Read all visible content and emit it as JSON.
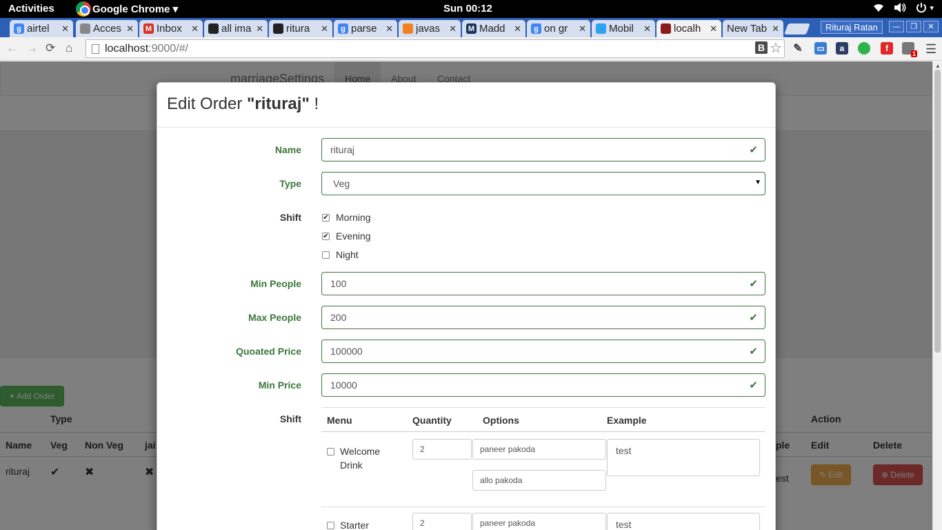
{
  "system": {
    "activities": "Activities",
    "app_name": "Google Chrome ▾",
    "clock": "Sun 00:12",
    "tray": [
      "wifi-icon",
      "volume-icon",
      "power-icon"
    ]
  },
  "browser": {
    "tabs": [
      {
        "label": "airtel",
        "icon": "g",
        "color": "#4285f4"
      },
      {
        "label": "Acces",
        "icon": "",
        "color": "#888888"
      },
      {
        "label": "Inbox",
        "icon": "M",
        "color": "#d93025"
      },
      {
        "label": "all ima",
        "icon": "",
        "color": "#222222"
      },
      {
        "label": "ritura",
        "icon": "",
        "color": "#222222"
      },
      {
        "label": "parse",
        "icon": "g",
        "color": "#4285f4"
      },
      {
        "label": "javas",
        "icon": "",
        "color": "#f48024"
      },
      {
        "label": "Madd",
        "icon": "M",
        "color": "#1b365d"
      },
      {
        "label": "on gr",
        "icon": "g",
        "color": "#4285f4"
      },
      {
        "label": "Mobil",
        "icon": "",
        "color": "#2ea3f2"
      },
      {
        "label": "localh",
        "icon": "",
        "color": "#8b1a1a"
      },
      {
        "label": "New Tab",
        "icon": "",
        "color": "#2c5fb6"
      }
    ],
    "profile": "Rituraj Ratan",
    "url_host": "localhost",
    "url_path": ":9000/#/",
    "ext_b": "B",
    "ext_badge": "1"
  },
  "page": {
    "brand": "marriageSettings",
    "nav": [
      "Home",
      "About",
      "Contact"
    ],
    "add_button": "Add Order",
    "table": {
      "group_type": "Type",
      "group_action": "Action",
      "headers": [
        "Name",
        "Veg",
        "Non Veg",
        "jai"
      ],
      "header_people": "ple",
      "header_edit": "Edit",
      "header_delete": "Delete",
      "row": {
        "name": "rituraj",
        "veg": "✔",
        "nonveg": "✖",
        "jain": "✖",
        "example": "est"
      },
      "edit_label": "Edit",
      "delete_label": "Delete"
    }
  },
  "modal": {
    "title_prefix": "Edit Order ",
    "title_name": "\"rituraj\"",
    "title_suffix": " !",
    "fields": {
      "name_label": "Name",
      "name_value": "rituraj",
      "type_label": "Type",
      "type_value": "Veg",
      "shift_label": "Shift",
      "min_people_label": "Min People",
      "min_people_value": "100",
      "max_people_label": "Max People",
      "max_people_value": "200",
      "quoted_price_label": "Quoated Price",
      "quoted_price_value": "100000",
      "min_price_label": "Min Price",
      "min_price_value": "10000",
      "menu_label": "Shift"
    },
    "shifts": [
      {
        "label": "Morning",
        "checked": true
      },
      {
        "label": "Evening",
        "checked": true
      },
      {
        "label": "Night",
        "checked": false
      }
    ],
    "menu_table": {
      "headers": [
        "Menu",
        "Quantity",
        "Options",
        "Example"
      ],
      "rows": [
        {
          "menu": "Welcome Drink",
          "checked": false,
          "quantity": "2",
          "options": [
            "paneer pakoda",
            "allo pakoda"
          ],
          "example": "test"
        },
        {
          "menu": "Starter",
          "checked": false,
          "quantity": "2",
          "options": [
            "paneer pakoda"
          ],
          "example": "test"
        }
      ]
    }
  }
}
